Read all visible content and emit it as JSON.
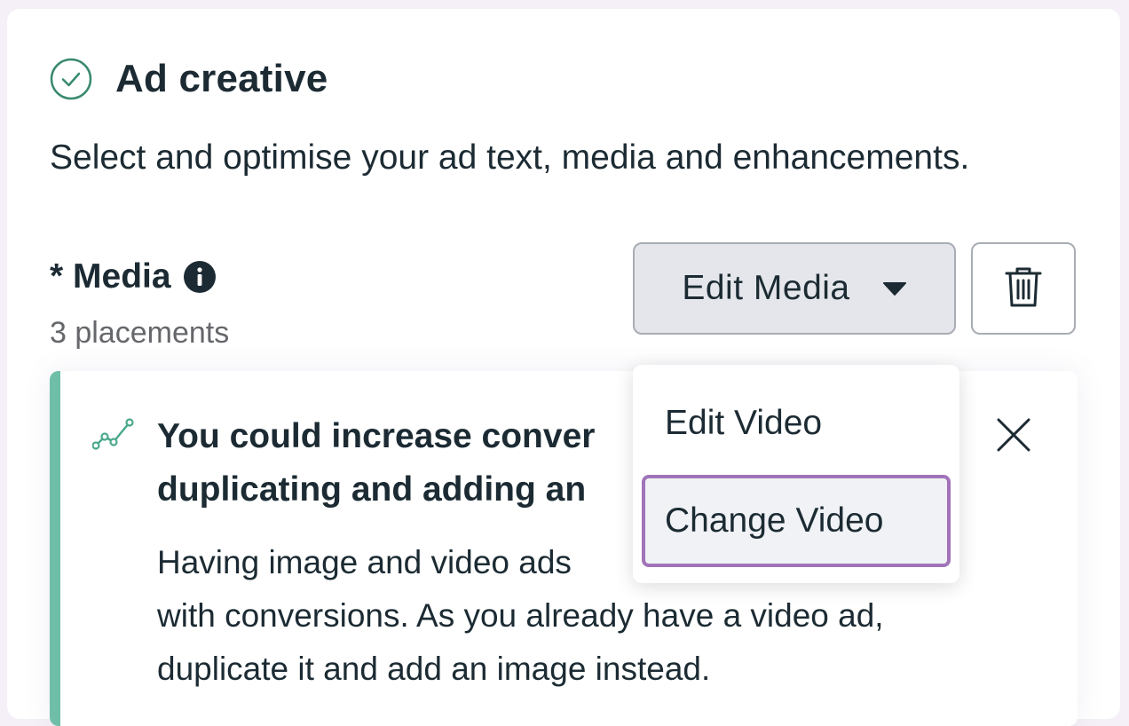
{
  "section": {
    "title": "Ad creative",
    "description": "Select and optimise your ad text, media and enhancements.",
    "status_icon": "check-circle-icon"
  },
  "media": {
    "label": "* Media",
    "info_icon": "info-icon",
    "placements": "3 placements",
    "edit_button_label": "Edit Media",
    "delete_icon": "trash-icon"
  },
  "dropdown": {
    "items": [
      {
        "label": "Edit Video"
      },
      {
        "label": "Change Video",
        "focused": true
      }
    ]
  },
  "suggestion": {
    "icon": "trend-line-icon",
    "title": "You could increase conver duplicating and adding an",
    "title_line1": "You could increase conver",
    "title_line2": "duplicating and adding an",
    "body_line1": "Having image and video ads",
    "body_line1_tail": "s",
    "body_line2": "with conversions. As you already have a video ad,",
    "body_line3": "duplicate it and add an image instead.",
    "accent_color": "#6fbfa8"
  },
  "colors": {
    "check_green": "#3a8a6e",
    "focus_outline": "#a173b8",
    "button_bg": "#e4e6eb"
  }
}
